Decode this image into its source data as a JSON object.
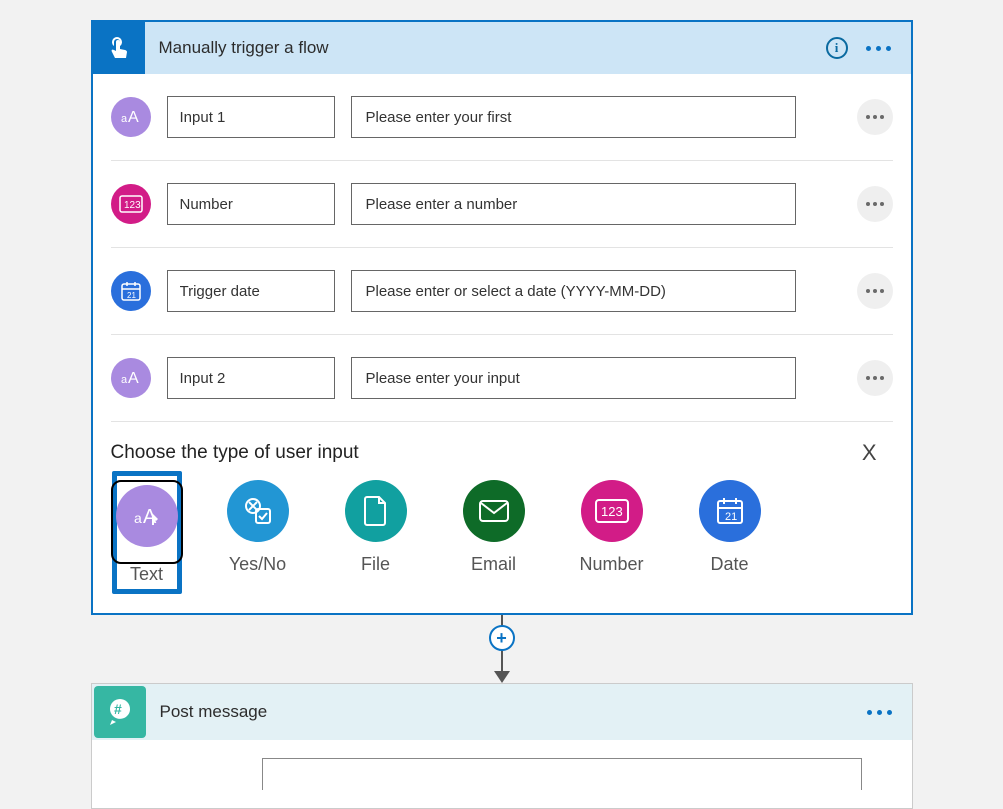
{
  "trigger": {
    "title": "Manually trigger a flow",
    "inputs": [
      {
        "name": "Input 1",
        "placeholder": "Please enter your first",
        "badge": "text"
      },
      {
        "name": "Number",
        "placeholder": "Please enter a number",
        "badge": "number"
      },
      {
        "name": "Trigger date",
        "placeholder": "Please enter or select a date (YYYY-MM-DD)",
        "badge": "date"
      },
      {
        "name": "Input 2",
        "placeholder": "Please enter your input",
        "badge": "text"
      }
    ],
    "chooser": {
      "prompt": "Choose the type of user input",
      "close": "X",
      "types": [
        {
          "key": "text",
          "label": "Text"
        },
        {
          "key": "yesno",
          "label": "Yes/No"
        },
        {
          "key": "file",
          "label": "File"
        },
        {
          "key": "email",
          "label": "Email"
        },
        {
          "key": "number",
          "label": "Number"
        },
        {
          "key": "date",
          "label": "Date"
        }
      ],
      "selected": "text"
    }
  },
  "action": {
    "title": "Post message"
  },
  "icons": {
    "info": "i",
    "plus": "+"
  }
}
